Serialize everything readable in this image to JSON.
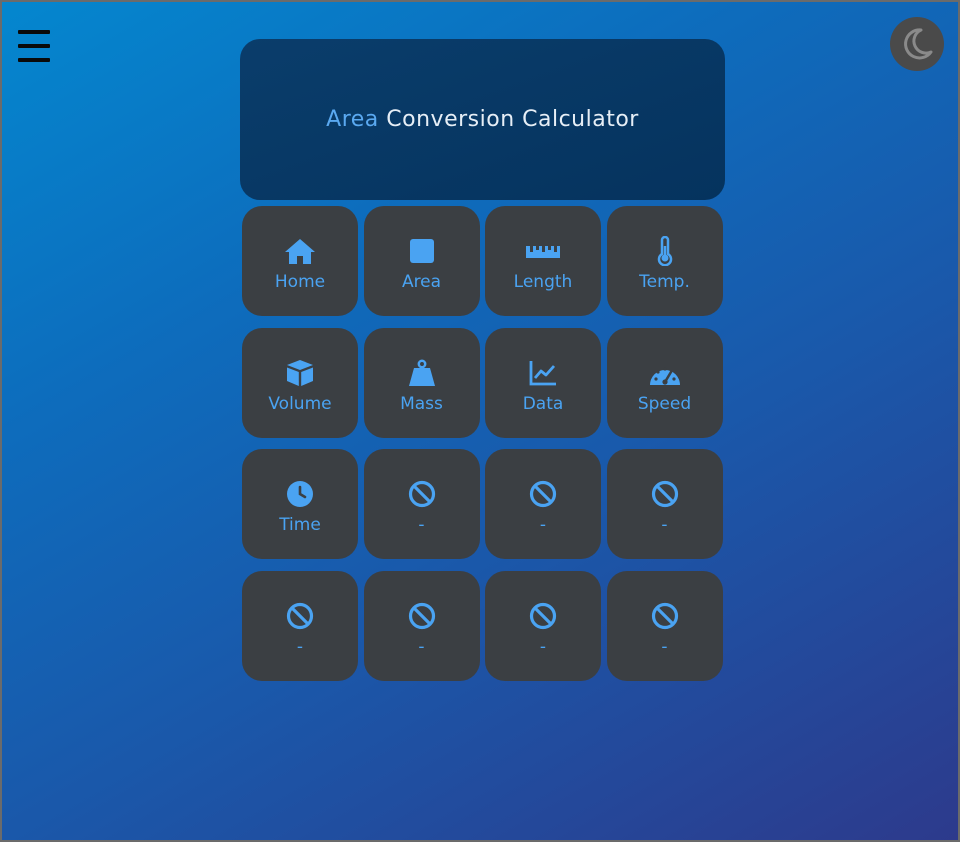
{
  "header": {
    "title_accent": "Area",
    "title_rest": " Conversion Calculator"
  },
  "colors": {
    "accent": "#4aa3f2",
    "tile_bg": "#3b3f43",
    "header_bg": "#05335e"
  },
  "tiles": [
    {
      "label": "Home",
      "icon": "home-icon"
    },
    {
      "label": "Area",
      "icon": "square-icon"
    },
    {
      "label": "Length",
      "icon": "ruler-icon"
    },
    {
      "label": "Temp.",
      "icon": "thermometer-icon"
    },
    {
      "label": "Volume",
      "icon": "cube-icon"
    },
    {
      "label": "Mass",
      "icon": "weight-icon"
    },
    {
      "label": "Data",
      "icon": "chart-line-icon"
    },
    {
      "label": "Speed",
      "icon": "gauge-icon"
    },
    {
      "label": "Time",
      "icon": "clock-icon"
    },
    {
      "label": "-",
      "icon": "ban-icon"
    },
    {
      "label": "-",
      "icon": "ban-icon"
    },
    {
      "label": "-",
      "icon": "ban-icon"
    },
    {
      "label": "-",
      "icon": "ban-icon"
    },
    {
      "label": "-",
      "icon": "ban-icon"
    },
    {
      "label": "-",
      "icon": "ban-icon"
    },
    {
      "label": "-",
      "icon": "ban-icon"
    }
  ],
  "controls": {
    "menu_icon": "hamburger-menu-icon",
    "theme_icon": "moon-icon"
  }
}
